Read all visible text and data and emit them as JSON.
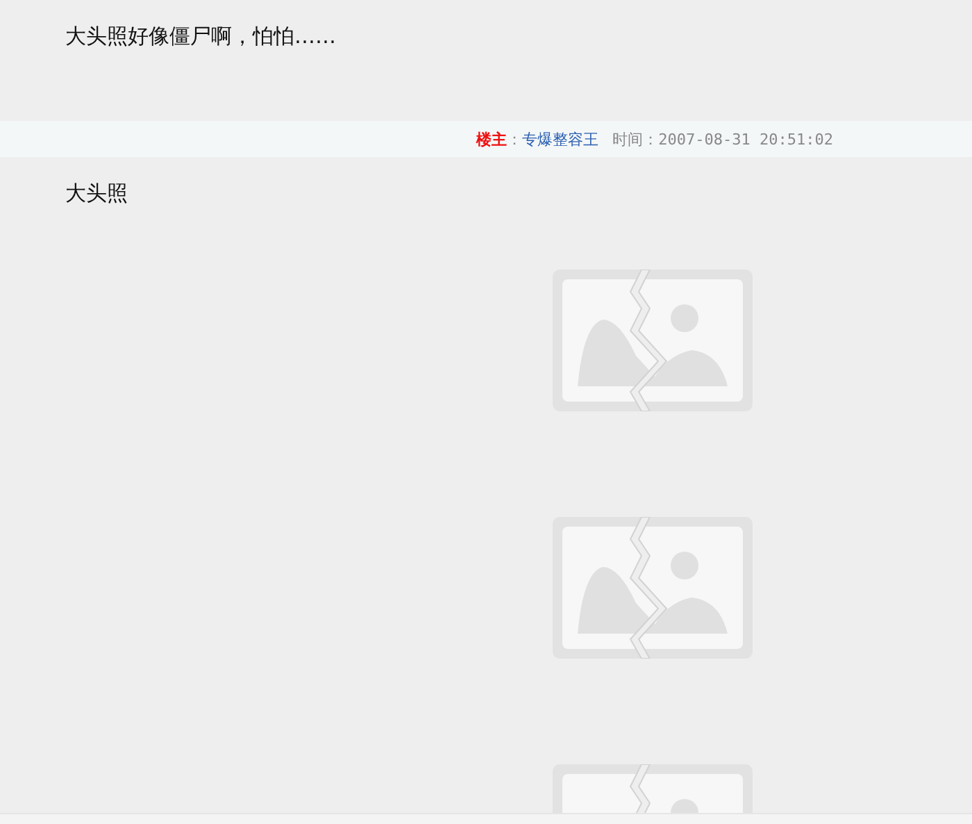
{
  "reply": {
    "text": "大头照好像僵尸啊，怕怕……"
  },
  "post_meta": {
    "author_label": "楼主",
    "separator": "：",
    "author": "专爆整容王",
    "time_label": "时间：",
    "time": "2007-08-31 20:51:02"
  },
  "post": {
    "text": "大头照",
    "images": [
      {
        "kind": "broken-image"
      },
      {
        "kind": "broken-image"
      },
      {
        "kind": "broken-image"
      }
    ]
  }
}
